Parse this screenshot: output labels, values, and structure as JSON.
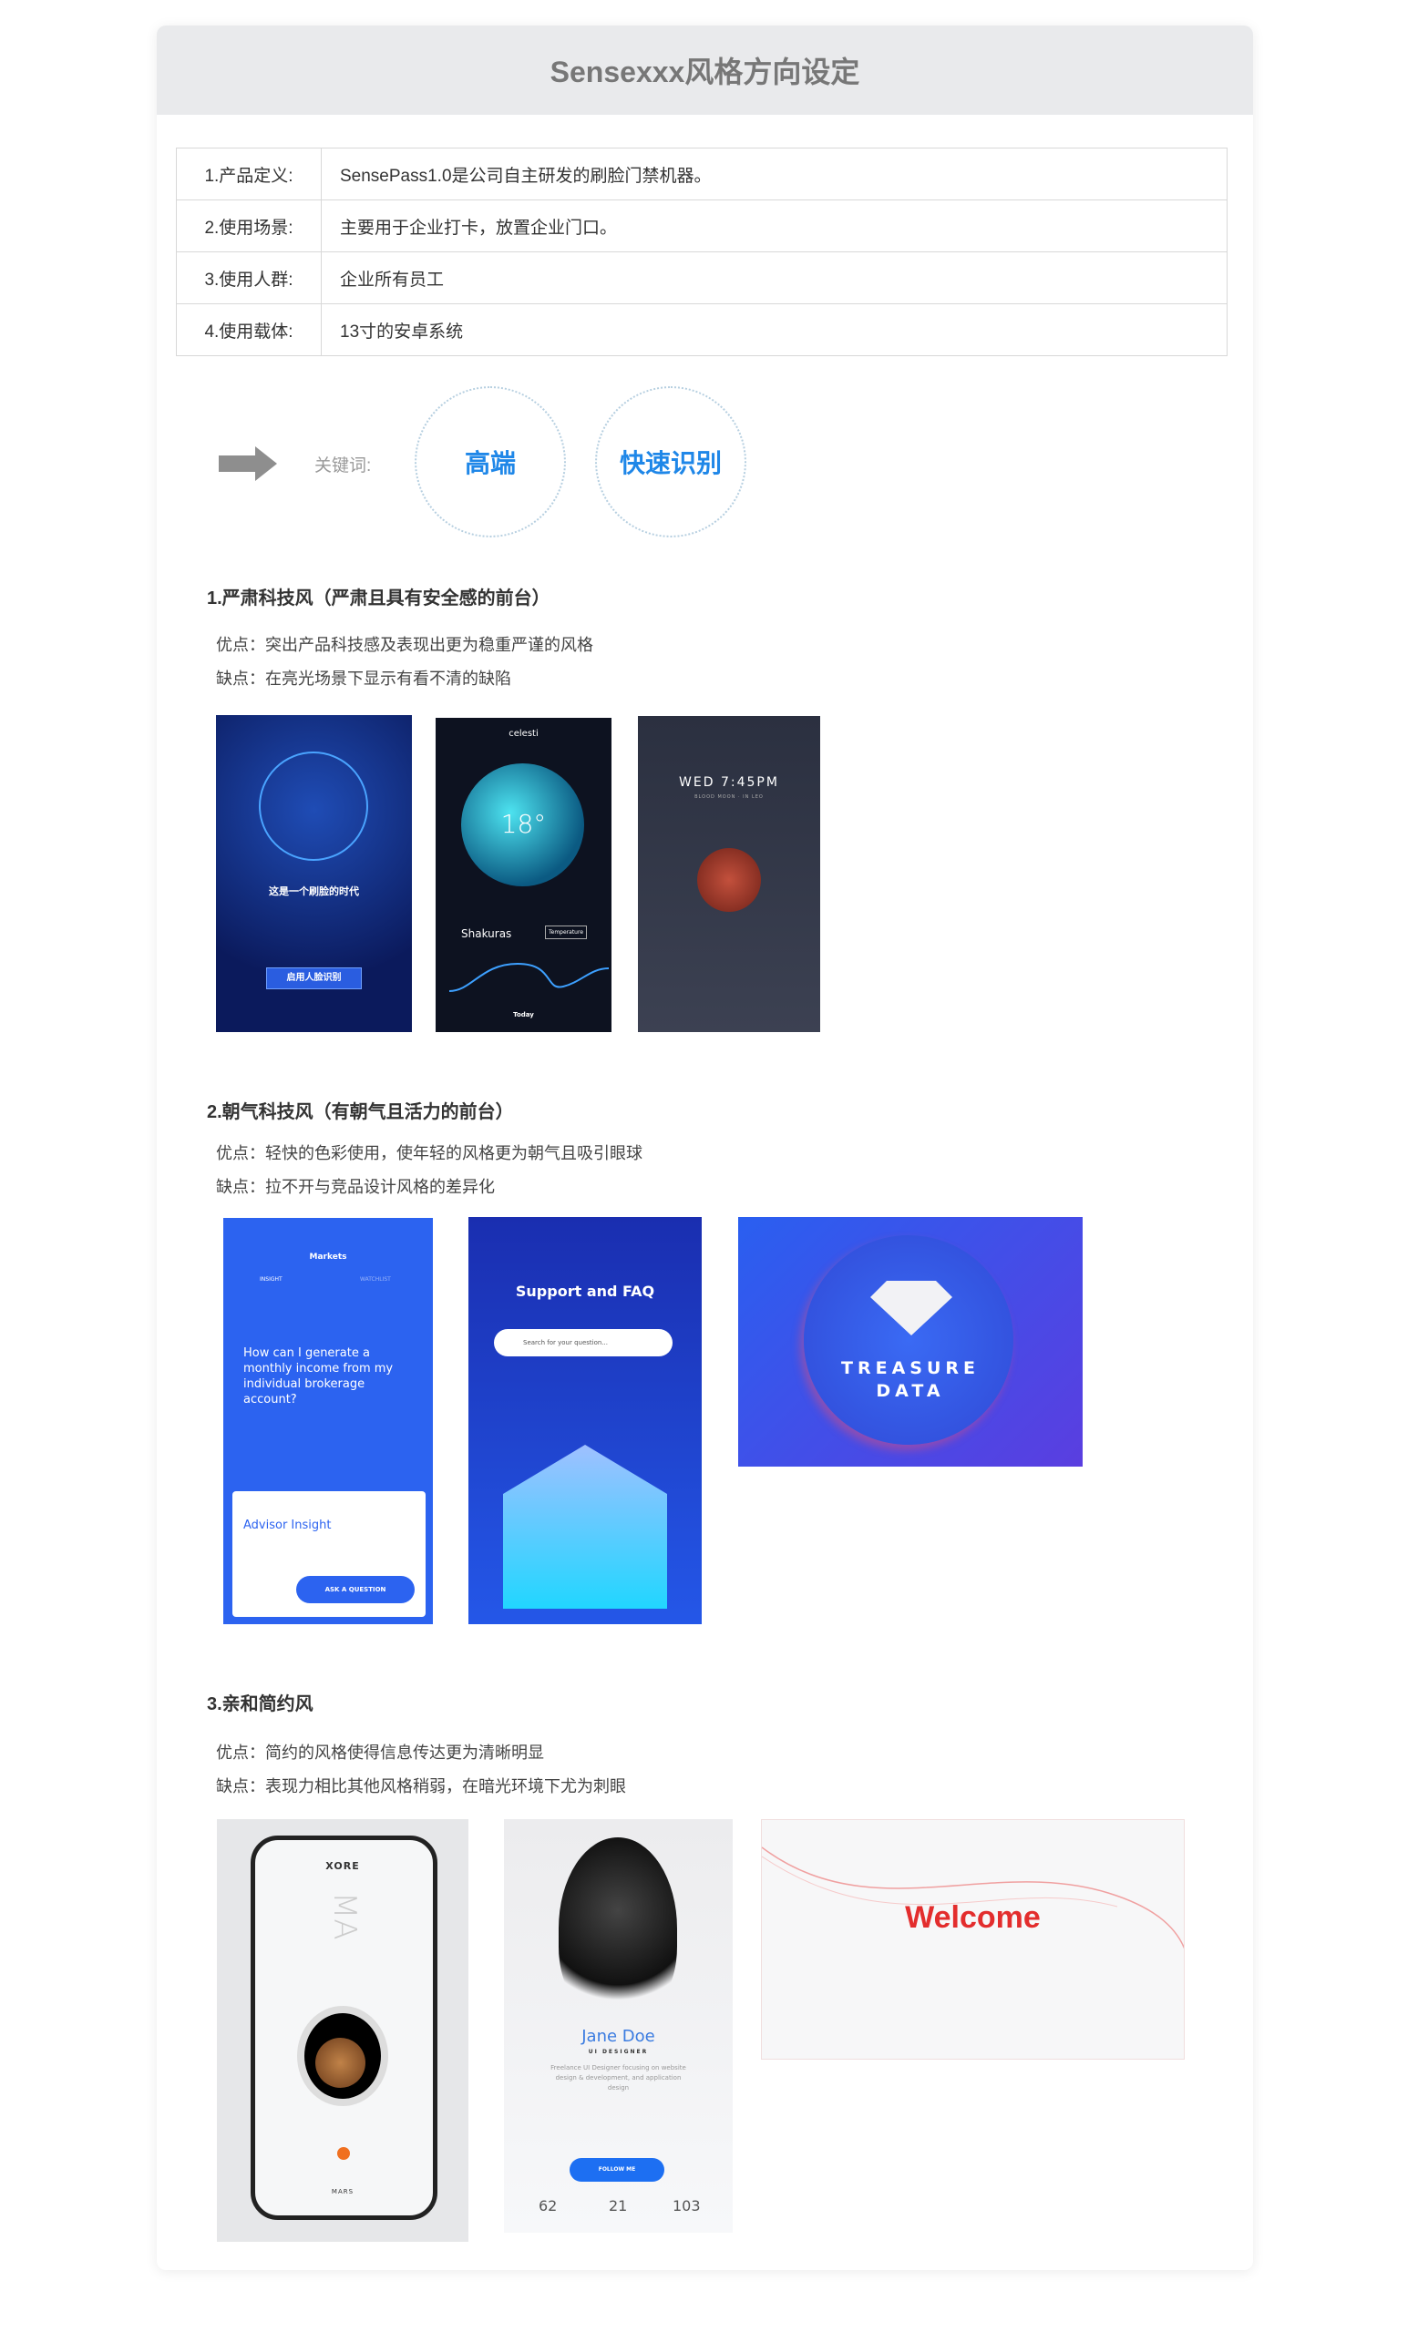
{
  "title": "Sensexxx风格方向设定",
  "table": [
    {
      "label": "1.产品定义:",
      "value": "SensePass1.0是公司自主研发的刷脸门禁机器。"
    },
    {
      "label": "2.使用场景:",
      "value": "主要用于企业打卡，放置企业门口。"
    },
    {
      "label": "3.使用人群:",
      "value": "企业所有员工"
    },
    {
      "label": "4.使用载体:",
      "value": "13寸的安卓系统"
    }
  ],
  "keywords": {
    "label": "关键词:",
    "items": [
      "高端",
      "快速识别"
    ],
    "accent": "#1f87e8"
  },
  "sections": [
    {
      "title": "1.严肃科技风（严肃且具有安全感的前台）",
      "pros": "优点：突出产品科技感及表现出更为稳重严谨的风格",
      "cons": "缺点：在亮光场景下显示有看不清的缺陷",
      "images": [
        {
          "text": "这是一个刷脸的时代",
          "button": "启用人脸识别"
        },
        {
          "app": "celesti",
          "temp": "18°",
          "city": "Shakuras",
          "dropdown": "Temperature",
          "day": "Today"
        },
        {
          "time": "WED 7:45PM",
          "sub": "BLOOD MOON · IN LEO"
        }
      ]
    },
    {
      "title": "2.朝气科技风（有朝气且活力的前台）",
      "pros": "优点：轻快的色彩使用，使年轻的风格更为朝气且吸引眼球",
      "cons": "缺点：拉不开与竞品设计风格的差异化",
      "images": [
        {
          "header": "Markets",
          "tab1": "INSIGHT",
          "tab2": "WATCHLIST",
          "question": "How can I generate a monthly income from my individual brokerage account?",
          "card_title": "Advisor Insight",
          "button": "ASK A QUESTION"
        },
        {
          "title": "Support and FAQ",
          "search": "Search for your question..."
        },
        {
          "line1": "TREASURE",
          "line2": "DATA"
        }
      ]
    },
    {
      "title": "3.亲和简约风",
      "pros": "优点：简约的风格使得信息传达更为清晰明显",
      "cons": "缺点：表现力相比其他风格稍弱，在暗光环境下尤为刺眼",
      "images": [
        {
          "brand": "XORE",
          "big": "MA",
          "planet": "MARS"
        },
        {
          "name": "Jane Doe",
          "role": "UI DESIGNER",
          "bio": "Freelance UI Designer focusing on website design & development, and application design",
          "button": "FOLLOW ME",
          "stats": [
            "62",
            "21",
            "103"
          ]
        },
        {
          "headline": "Welcome"
        }
      ]
    }
  ]
}
